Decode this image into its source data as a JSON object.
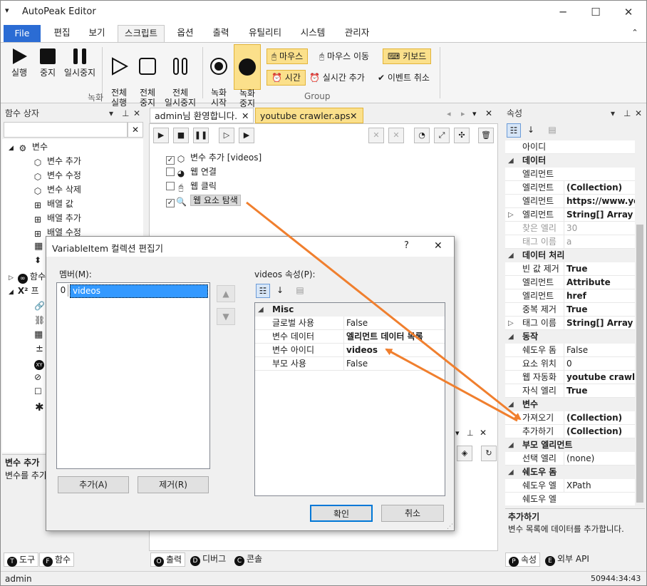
{
  "app": {
    "title": "AutoPeak Editor",
    "menu_icon": "▾"
  },
  "window_controls": {
    "minimize": "─",
    "maximize": "☐",
    "close": "✕"
  },
  "menu": {
    "file": "File",
    "tabs": [
      "편집",
      "보기",
      "스크립트",
      "옵션",
      "출력",
      "유틸리티",
      "시스템",
      "관리자"
    ],
    "selected": "스크립트",
    "collapse_icon": "⌃"
  },
  "ribbon": {
    "record_group": {
      "label": "녹화",
      "buttons": [
        {
          "label": "실행",
          "icon": "play-icon"
        },
        {
          "label": "중지",
          "icon": "stop-icon"
        },
        {
          "label": "일시중지",
          "icon": "pause-icon"
        },
        {
          "label": "전체\n실행",
          "icon": "play-outline-icon"
        },
        {
          "label": "전체\n중지",
          "icon": "stop-outline-icon"
        },
        {
          "label": "전체\n일시중지",
          "icon": "pause-outline-icon"
        }
      ]
    },
    "group": {
      "label": "Group",
      "buttons": [
        {
          "label": "녹화\n시작",
          "icon": "record-start-icon"
        },
        {
          "label": "녹화\n중지",
          "icon": "record-stop-icon"
        }
      ],
      "pills": [
        {
          "label": "마우스",
          "active": true
        },
        {
          "label": "마우스 이동",
          "active": false
        },
        {
          "label": "키보드",
          "active": true
        },
        {
          "label": "시간",
          "active": true
        },
        {
          "label": "실시간 추가",
          "active": false
        },
        {
          "label": "이벤트 취소",
          "active": false
        }
      ]
    }
  },
  "left_panel": {
    "title": "함수 상자",
    "pin_icons": [
      "▾",
      "⊥",
      "✕"
    ],
    "search_value": "",
    "tree": [
      {
        "label": "변수",
        "level": 0,
        "expand": "◢"
      },
      {
        "label": "변수 추가",
        "level": 1
      },
      {
        "label": "변수 수정",
        "level": 1
      },
      {
        "label": "변수 삭제",
        "level": 1
      },
      {
        "label": "배열 값",
        "level": 1
      },
      {
        "label": "배열 추가",
        "level": 1
      },
      {
        "label": "배열 수정",
        "level": 1
      }
    ],
    "partial_rows": [
      "함수",
      "프"
    ],
    "desc_title": "변수 추가",
    "desc_text": "변수를 추가"
  },
  "doc_tabs": [
    {
      "label": "admin님 환영합니다.",
      "active": false
    },
    {
      "label": "youtube crawler.aps",
      "active": true
    }
  ],
  "script_items": [
    {
      "checked": true,
      "text": "변수 추가 [videos]",
      "highlight": false
    },
    {
      "checked": false,
      "text": "웹 연결",
      "highlight": false
    },
    {
      "checked": false,
      "text": "웹 클릭",
      "highlight": false
    },
    {
      "checked": true,
      "text": "웹 요소 탐색",
      "highlight": true
    }
  ],
  "right_panel": {
    "title": "속성",
    "rows": [
      {
        "type": "row",
        "key": "아이디",
        "value": ""
      },
      {
        "type": "cat",
        "key": "데이터"
      },
      {
        "type": "row",
        "key": "엘리먼트",
        "value": ""
      },
      {
        "type": "row",
        "key": "엘리먼트",
        "value": "(Collection)",
        "bold": true
      },
      {
        "type": "row",
        "key": "엘리먼트",
        "value": "https://www.you",
        "bold": true
      },
      {
        "type": "row",
        "key": "엘리먼트",
        "value": "String[] Array",
        "bold": true,
        "expand": true
      },
      {
        "type": "row",
        "key": "찾은 엘리",
        "value": "30",
        "gray": true
      },
      {
        "type": "row",
        "key": "태그 이름",
        "value": "a",
        "gray": true
      },
      {
        "type": "cat",
        "key": "데이터 처리"
      },
      {
        "type": "row",
        "key": "빈 값 제거",
        "value": "True",
        "bold": true
      },
      {
        "type": "row",
        "key": "엘리먼트",
        "value": "Attribute",
        "bold": true
      },
      {
        "type": "row",
        "key": "엘리먼트",
        "value": "href",
        "bold": true
      },
      {
        "type": "row",
        "key": "중복 제거",
        "value": "True",
        "bold": true
      },
      {
        "type": "row",
        "key": "태그 이름",
        "value": "String[] Array",
        "bold": true,
        "expand": true
      },
      {
        "type": "cat",
        "key": "동작"
      },
      {
        "type": "row",
        "key": "쉐도우 돔",
        "value": "False"
      },
      {
        "type": "row",
        "key": "요소 위치",
        "value": "0"
      },
      {
        "type": "row",
        "key": "웹 자동화",
        "value": "youtube crawler",
        "bold": true
      },
      {
        "type": "row",
        "key": "자식 엘리",
        "value": "True",
        "bold": true
      },
      {
        "type": "cat",
        "key": "변수"
      },
      {
        "type": "row",
        "key": "가져오기",
        "value": "(Collection)",
        "bold": true
      },
      {
        "type": "row",
        "key": "추가하기",
        "value": "(Collection)",
        "bold": true
      },
      {
        "type": "cat",
        "key": "부모 엘리먼트"
      },
      {
        "type": "row",
        "key": "선택 엘리",
        "value": "(none)"
      },
      {
        "type": "cat",
        "key": "쉐도우 돔"
      },
      {
        "type": "row",
        "key": "쉐도우 엘",
        "value": "XPath"
      },
      {
        "type": "row",
        "key": "쉐도우 엘",
        "value": ""
      }
    ],
    "desc_title": "추가하기",
    "desc_text": "변수 목록에 데이터를 추가합니다."
  },
  "bottom_tabs_left": [
    {
      "letter": "T",
      "label": "도구"
    },
    {
      "letter": "F",
      "label": "함수"
    }
  ],
  "bottom_tabs_mid": [
    {
      "letter": "O",
      "label": "출력"
    },
    {
      "letter": "D",
      "label": "디버그"
    },
    {
      "letter": "C",
      "label": "콘솔"
    }
  ],
  "bottom_tabs_right": [
    {
      "letter": "P",
      "label": "속성"
    },
    {
      "letter": "E",
      "label": "외부 API"
    }
  ],
  "status": {
    "user": "admin",
    "time": "50944:34:43"
  },
  "dialog": {
    "title": "VariableItem 컬렉션 편집기",
    "help": "?",
    "close": "✕",
    "members_label": "멤버(M):",
    "members": [
      {
        "index": "0",
        "name": "videos"
      }
    ],
    "props_label": "videos 속성(P):",
    "category": "Misc",
    "props": [
      {
        "key": "글로벌 사용",
        "value": "False",
        "bold": false
      },
      {
        "key": "변수 데이터",
        "value": "엘리먼트 데이터 목록",
        "bold": true
      },
      {
        "key": "변수 아이디",
        "value": "videos",
        "bold": true
      },
      {
        "key": "부모 사용",
        "value": "False",
        "bold": false
      }
    ],
    "add_button": "추가(A)",
    "remove_button": "제거(R)",
    "ok_button": "확인",
    "cancel_button": "취소",
    "up_icon": "🡅",
    "down_icon": "🡇"
  },
  "colors": {
    "accent": "#2b6cd4",
    "highlight": "#fbe08b",
    "arrow": "#f07f2e",
    "selection": "#3399ff"
  }
}
